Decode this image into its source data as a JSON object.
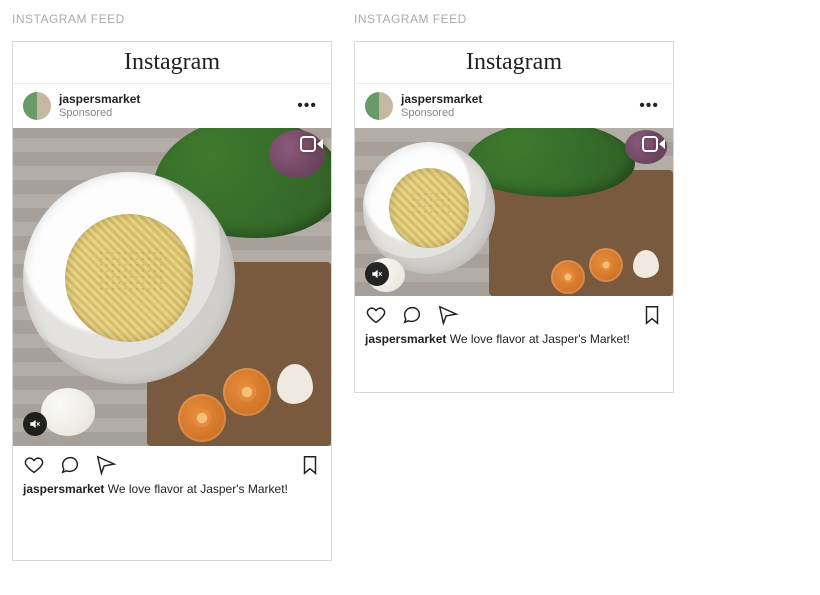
{
  "section_label": "INSTAGRAM FEED",
  "brand": "Instagram",
  "posts": [
    {
      "username": "jaspersmarket",
      "sponsored": "Sponsored",
      "caption_user": "jaspersmarket",
      "caption_text": " We love flavor at Jasper's Market!"
    },
    {
      "username": "jaspersmarket",
      "sponsored": "Sponsored",
      "caption_user": "jaspersmarket",
      "caption_text": " We love flavor at Jasper's Market!"
    }
  ]
}
